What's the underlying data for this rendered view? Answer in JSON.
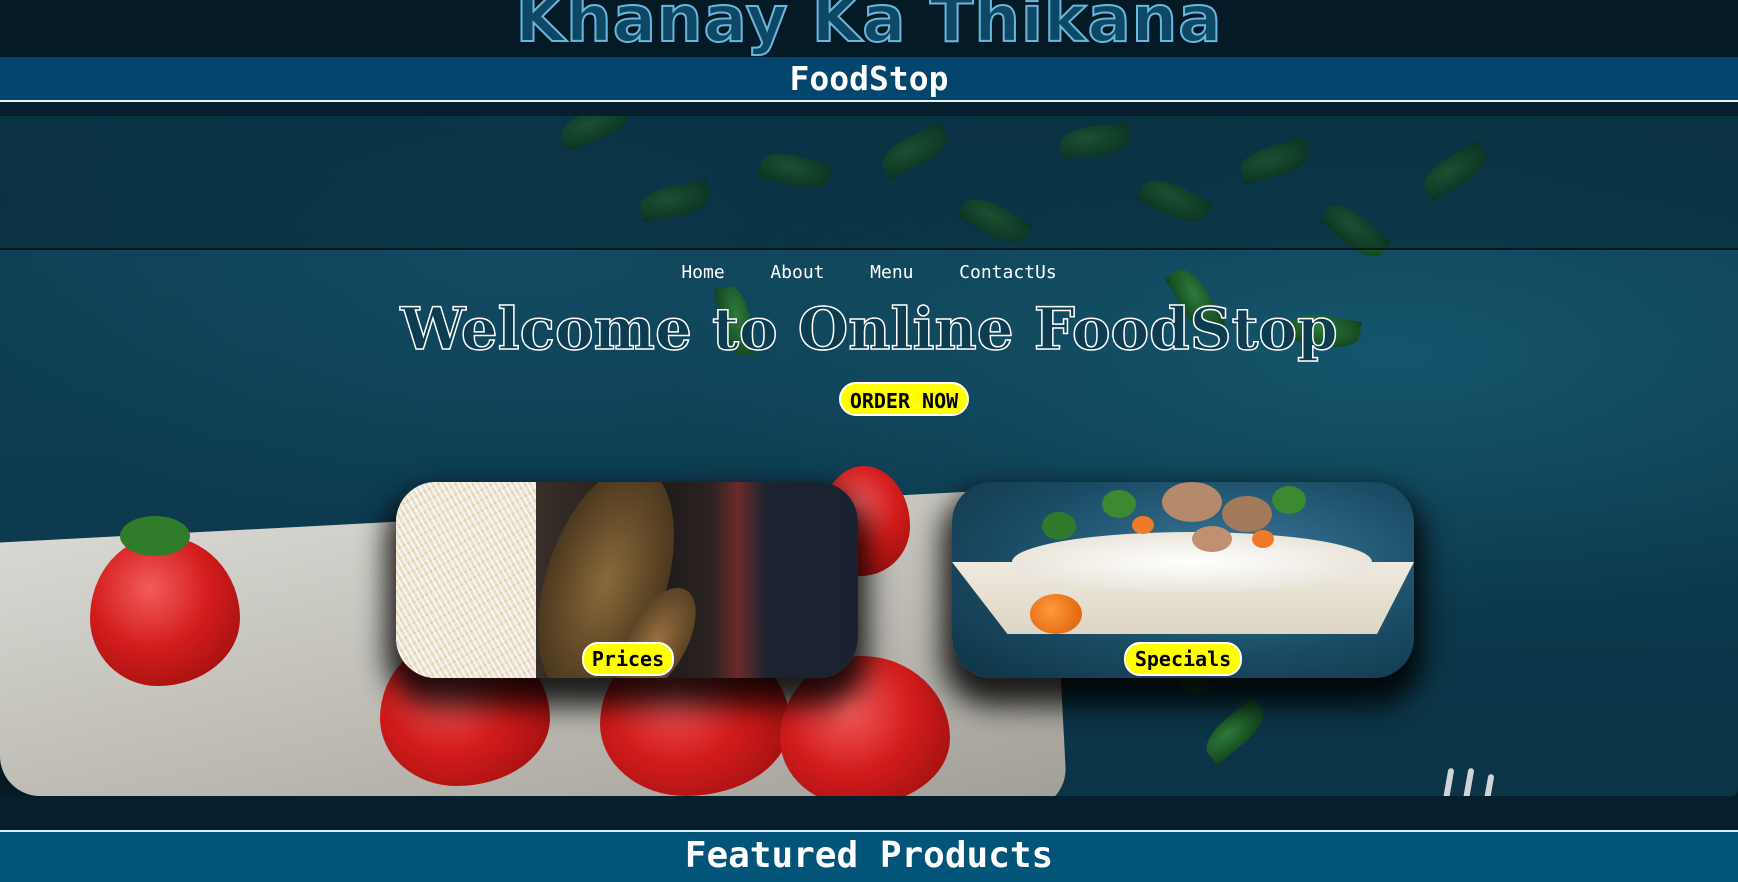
{
  "site": {
    "title": "Khanay Ka Thikana",
    "brand": "FoodStop"
  },
  "nav": {
    "items": [
      "Home",
      "About",
      "Menu",
      "ContactUs"
    ]
  },
  "hero": {
    "heading": "Welcome to Online FoodStop",
    "cta_label": "ORDER NOW"
  },
  "cards": [
    {
      "label": "Prices"
    },
    {
      "label": "Specials"
    }
  ],
  "featured": {
    "heading": "Featured Products"
  },
  "colors": {
    "accent": "#ffff00",
    "header_bg": "#02466d",
    "featured_bg": "#025478",
    "page_bg": "#041a24"
  }
}
